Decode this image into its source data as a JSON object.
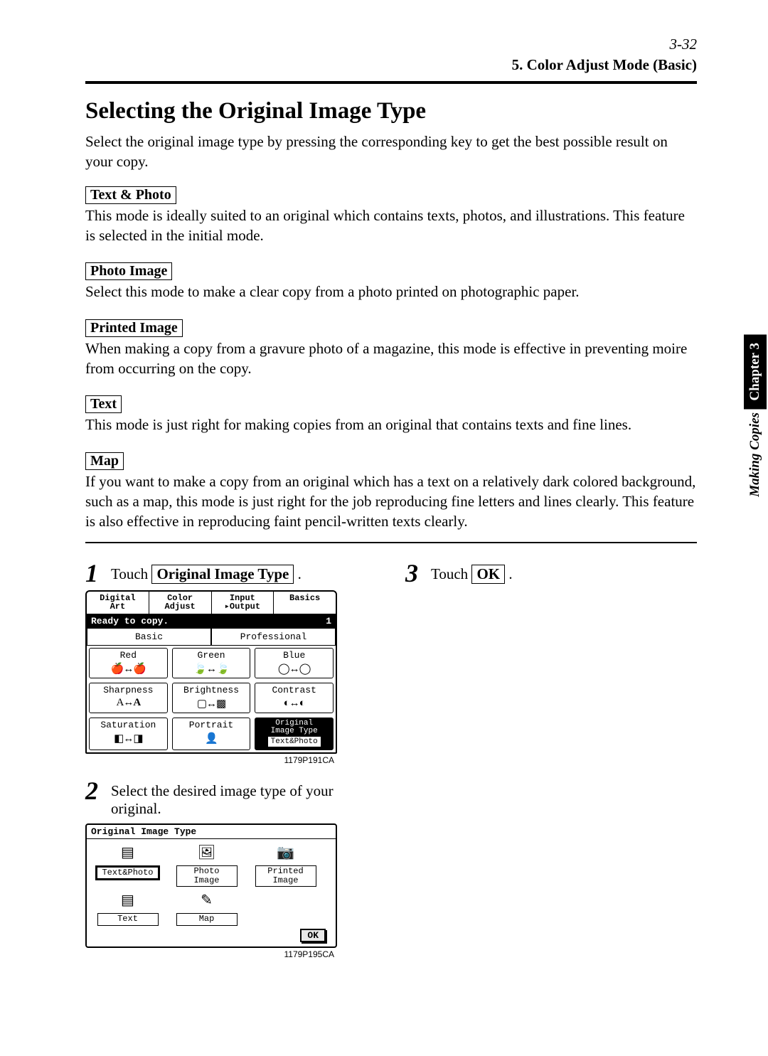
{
  "header": {
    "page_number": "3-32",
    "section_line": "5. Color Adjust Mode (Basic)"
  },
  "title": "Selecting the Original Image Type",
  "intro": "Select the original image type by pressing the corresponding key to get the best possible result on your copy.",
  "modes": {
    "text_photo": {
      "label": "Text & Photo",
      "desc": "This mode is ideally suited to an original which contains texts, photos, and illustrations. This feature is selected in the initial mode."
    },
    "photo_image": {
      "label": "Photo Image",
      "desc": "Select this mode to make a clear copy from a photo printed on photographic paper."
    },
    "printed_image": {
      "label": "Printed Image",
      "desc": "When making a copy from a gravure photo of a magazine, this mode is effective in preventing moire from occurring on the copy."
    },
    "text": {
      "label": "Text",
      "desc": "This mode is just right for making copies from an original that contains texts and fine lines."
    },
    "map": {
      "label": "Map",
      "desc": "If you want to make a copy from an original which has a text on a relatively dark colored background, such as a map, this mode is just right for the job reproducing fine letters and lines clearly. This feature is also effective in reproducing faint pencil-written texts clearly."
    }
  },
  "steps": {
    "s1": {
      "num": "1",
      "prefix": "Touch ",
      "button": "Original Image Type",
      "suffix": " ."
    },
    "s2": {
      "num": "2",
      "text": "Select the desired image type of your original."
    },
    "s3": {
      "num": "3",
      "prefix": "Touch ",
      "button": "OK",
      "suffix": " ."
    }
  },
  "panel1": {
    "tabs": {
      "t0": "Digital\nArt",
      "t1": "Color\nAdjust",
      "t2": "Input\n▸Output",
      "t3": "Basics"
    },
    "status_left": "Ready to copy.",
    "status_right": "1",
    "subtabs": {
      "basic": "Basic",
      "prof": "Professional"
    },
    "row1": {
      "red": "Red",
      "green": "Green",
      "blue": "Blue"
    },
    "row2": {
      "sharp": "Sharpness",
      "bright": "Brightness",
      "contrast": "Contrast"
    },
    "row3": {
      "sat": "Saturation",
      "port": "Portrait",
      "orig_label": "Original\nImage Type",
      "orig_sub": "Text&Photo"
    },
    "code": "1179P191CA"
  },
  "panel2": {
    "title": "Original Image Type",
    "opts": {
      "o0": "Text&Photo",
      "o1": "Photo\nImage",
      "o2": "Printed\nImage",
      "o3": "Text",
      "o4": "Map"
    },
    "ok": "OK",
    "code": "1179P195CA"
  },
  "sidetab": {
    "chapter": "Chapter 3",
    "making": "Making Copies"
  }
}
